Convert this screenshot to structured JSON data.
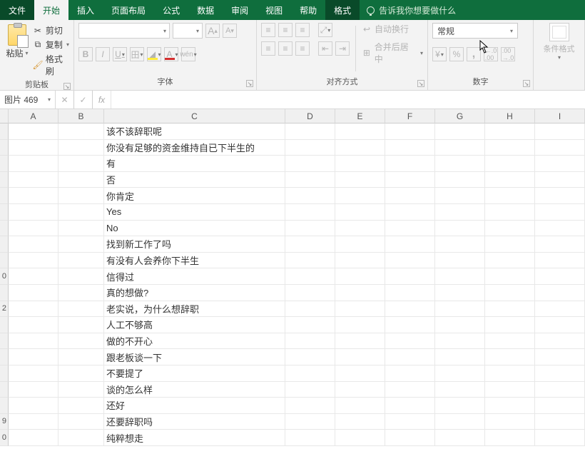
{
  "tabs": {
    "file": "文件",
    "home": "开始",
    "insert": "插入",
    "layout": "页面布局",
    "formula": "公式",
    "data": "数据",
    "review": "审阅",
    "view": "视图",
    "help": "帮助",
    "format": "格式",
    "tellme": "告诉我你想要做什么"
  },
  "ribbon": {
    "clipboard": {
      "paste": "粘贴",
      "cut": "剪切",
      "copy": "复制",
      "painter": "格式刷",
      "label": "剪贴板"
    },
    "font": {
      "name": "",
      "size": "",
      "grow": "A",
      "shrink": "A",
      "bold": "B",
      "italic": "I",
      "underline": "U",
      "border": "田",
      "wen": "wén",
      "label": "字体"
    },
    "align": {
      "wrap": "自动换行",
      "merge": "合并后居中",
      "label": "对齐方式"
    },
    "number": {
      "format": "常规",
      "percent": "%",
      "comma": ",",
      "inc": ".0",
      "dec": ".00",
      "label": "数字"
    },
    "cond": {
      "label": "条件格式"
    }
  },
  "fbar": {
    "name": "图片 469",
    "fx": "fx",
    "value": ""
  },
  "columns": {
    "widths": [
      70,
      64,
      254,
      70,
      70,
      70,
      70,
      70,
      70
    ],
    "labels": [
      "A",
      "B",
      "C",
      "D",
      "E",
      "F",
      "G",
      "H",
      "I"
    ]
  },
  "rows": [
    {
      "n": "",
      "c": "该不该辞职呢"
    },
    {
      "n": "",
      "c": "你没有足够的资金维持自已下半生的"
    },
    {
      "n": "",
      "c": "有"
    },
    {
      "n": "",
      "c": "否"
    },
    {
      "n": "",
      "c": "你肯定"
    },
    {
      "n": "",
      "c": "Yes"
    },
    {
      "n": "",
      "c": "No"
    },
    {
      "n": "",
      "c": "找到新工作了吗"
    },
    {
      "n": "",
      "c": "有没有人会养你下半生"
    },
    {
      "n": "0",
      "c": "信得过"
    },
    {
      "n": "",
      "c": "真的想做?"
    },
    {
      "n": "2",
      "c": "老实说，为什么想辞职"
    },
    {
      "n": "",
      "c": "人工不够高"
    },
    {
      "n": "",
      "c": "做的不开心"
    },
    {
      "n": "",
      "c": "跟老板谈一下"
    },
    {
      "n": "",
      "c": "不要提了"
    },
    {
      "n": "",
      "c": "谈的怎么样"
    },
    {
      "n": "",
      "c": "还好"
    },
    {
      "n": "9",
      "c": "还要辞职吗"
    },
    {
      "n": "0",
      "c": "纯粹想走"
    }
  ]
}
